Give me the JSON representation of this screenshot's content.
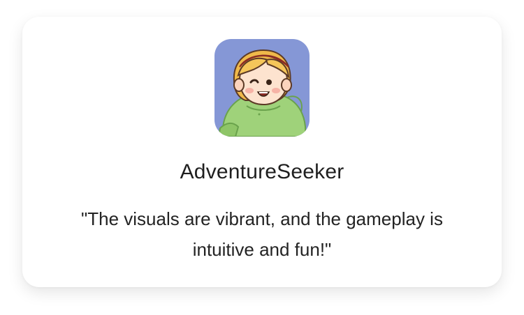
{
  "testimonial": {
    "username": "AdventureSeeker",
    "quote": "\"The visuals are vibrant, and the gameplay is\nintuitive and  fun!\"",
    "avatar_icon": "cartoon-girl-avatar-icon"
  },
  "colors": {
    "avatar_background": "#8597d6",
    "hoodie": "#9fd27a",
    "hair": "#f0b94a",
    "headband": "#d94f45"
  }
}
